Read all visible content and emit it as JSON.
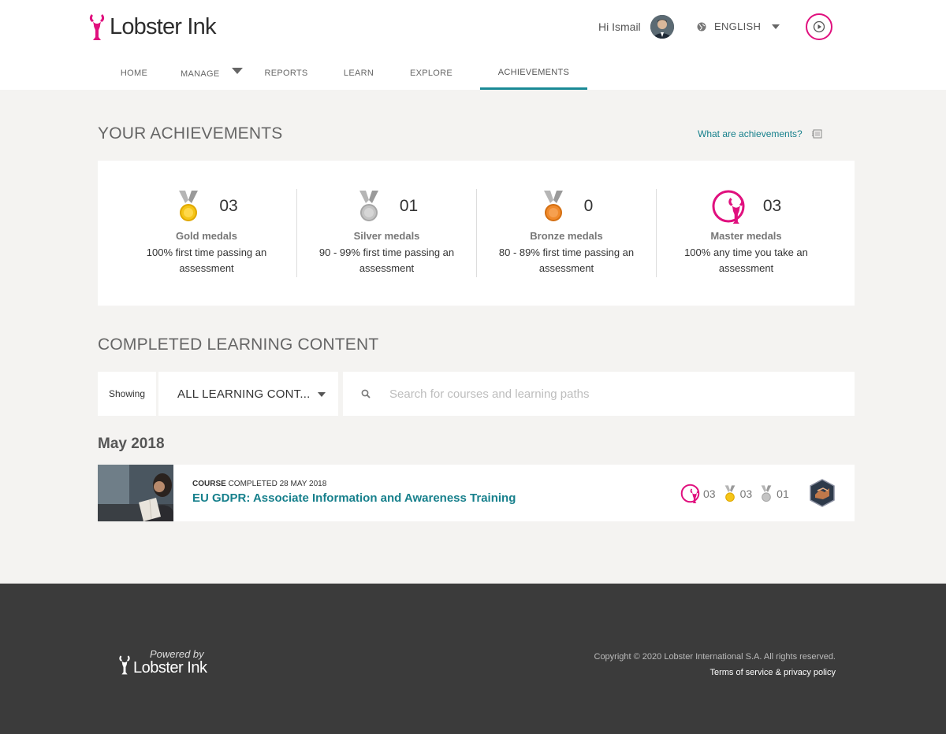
{
  "header": {
    "logo_text": "Lobster Ink",
    "greeting": "Hi Ismail",
    "language": "ENGLISH",
    "brand_color": "#e0107e",
    "accent_color": "#1a8a96"
  },
  "nav": {
    "items": [
      {
        "label": "HOME"
      },
      {
        "label": "MANAGE"
      },
      {
        "label": "REPORTS"
      },
      {
        "label": "LEARN"
      },
      {
        "label": "EXPLORE"
      },
      {
        "label": "ACHIEVEMENTS"
      }
    ],
    "active": "ACHIEVEMENTS"
  },
  "achievements": {
    "title": "YOUR ACHIEVEMENTS",
    "help_link": "What are achievements?",
    "medals": [
      {
        "count": "03",
        "name": "Gold medals",
        "desc": "100% first time passing an assessment",
        "icon": "gold-medal-icon"
      },
      {
        "count": "01",
        "name": "Silver medals",
        "desc": "90 - 99% first time passing an assessment",
        "icon": "silver-medal-icon"
      },
      {
        "count": "0",
        "name": "Bronze medals",
        "desc": "80 - 89% first time passing an assessment",
        "icon": "bronze-medal-icon"
      },
      {
        "count": "03",
        "name": "Master medals",
        "desc": "100% any time you take an assessment",
        "icon": "master-medal-icon"
      }
    ]
  },
  "completed": {
    "title": "COMPLETED LEARNING CONTENT",
    "showing_label": "Showing",
    "filter_value": "ALL LEARNING CONT...",
    "search_placeholder": "Search for courses and learning paths",
    "month": "May 2018",
    "items": [
      {
        "kind": "COURSE",
        "completed": "COMPLETED 28 MAY 2018",
        "title": "EU GDPR: Associate Information and Awareness Training",
        "master_count": "03",
        "gold_count": "03",
        "silver_count": "01"
      }
    ]
  },
  "footer": {
    "powered_by": "Powered by",
    "logo_text": "Lobster Ink",
    "copyright": "Copyright © 2020 Lobster International S.A. All rights reserved.",
    "terms": "Terms of service & privacy policy"
  }
}
